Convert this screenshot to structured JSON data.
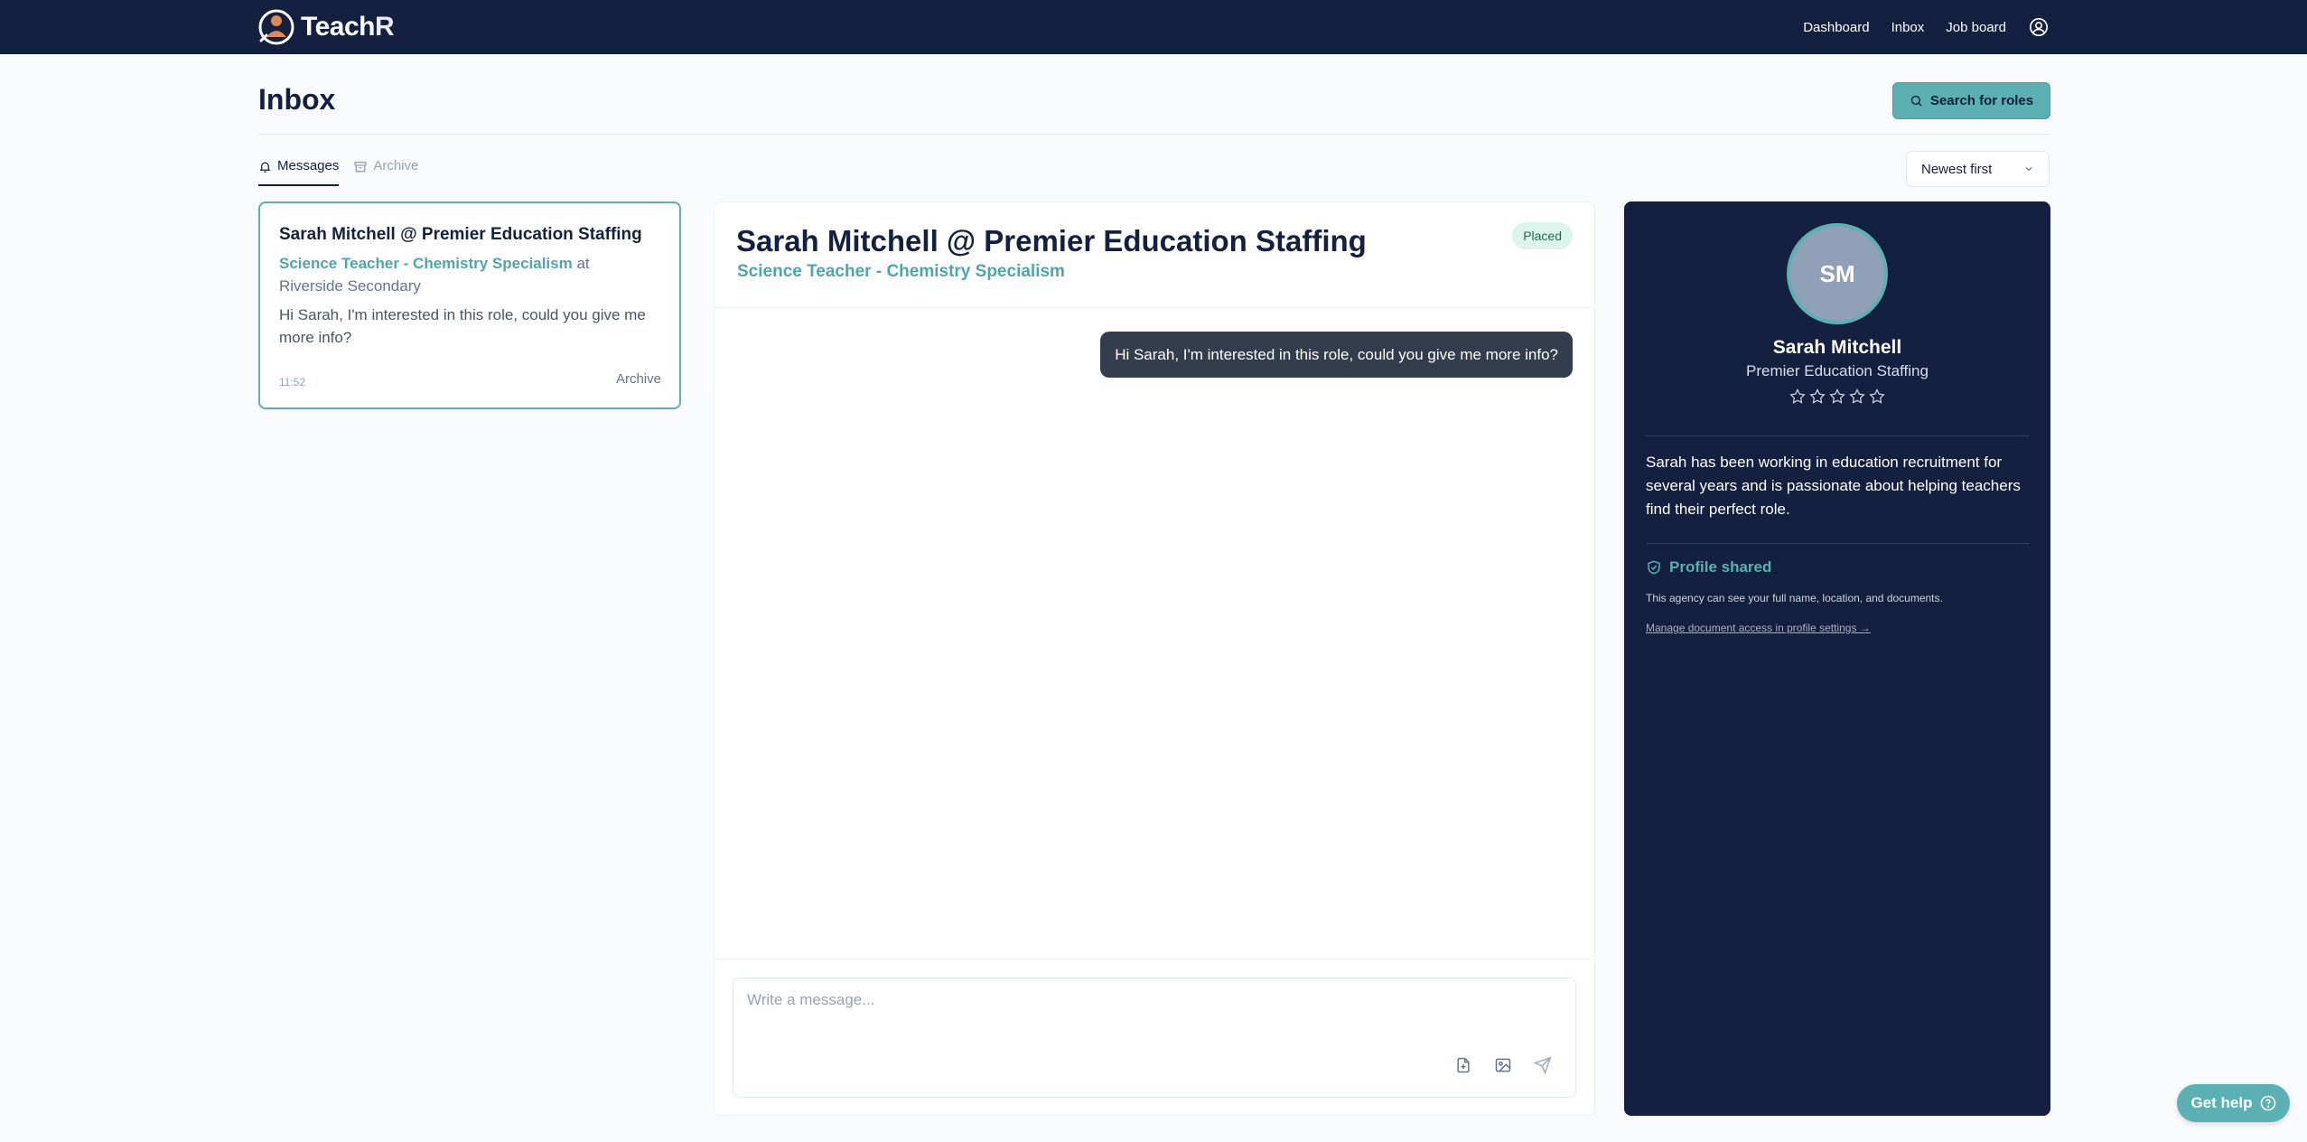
{
  "app": {
    "name_main": "Teach",
    "name_end": "R"
  },
  "nav": {
    "dashboard": "Dashboard",
    "inbox": "Inbox",
    "job_board": "Job board",
    "account_icon": "user-circle-icon"
  },
  "header": {
    "title": "Inbox",
    "search_button": "Search for roles"
  },
  "tabs": [
    {
      "label": "Messages",
      "icon": "bell-icon",
      "active": true
    },
    {
      "label": "Archive",
      "icon": "archive-box-icon",
      "active": false
    }
  ],
  "sort": {
    "selected": "Newest first"
  },
  "conversation": {
    "title": "Sarah Mitchell @ Premier Education Staffing",
    "role": "Science Teacher - Chemistry Specialism",
    "at": "at",
    "school": "Riverside Secondary",
    "preview": "Hi Sarah, I'm interested in this role, could you give me more info?",
    "time": "11:52",
    "archive_label": "Archive"
  },
  "chat": {
    "title": "Sarah Mitchell @ Premier Education Staffing",
    "role": "Science Teacher - Chemistry Specialism",
    "status": "Placed",
    "status_color": "#dbf5ec",
    "messages": [
      {
        "from": "me",
        "text": "Hi Sarah, I'm interested in this role, could you give me more info?"
      }
    ],
    "composer_placeholder": "Write a message...",
    "tools": [
      "attach-file-icon",
      "attach-image-icon",
      "send-icon"
    ]
  },
  "profile": {
    "initials": "SM",
    "name": "Sarah Mitchell",
    "agency": "Premier Education Staffing",
    "rating": 0,
    "rating_max": 5,
    "bio": "Sarah has been working in education recruitment for several years and is passionate about helping teachers find their perfect role.",
    "shared_label": "Profile shared",
    "shared_note": "This agency can see your full name, location, and documents.",
    "manage_link": "Manage document access in profile settings →"
  },
  "help": {
    "label": "Get help"
  },
  "colors": {
    "navy": "#14203f",
    "teal": "#5bb0b3",
    "bubble": "#343d4e"
  }
}
